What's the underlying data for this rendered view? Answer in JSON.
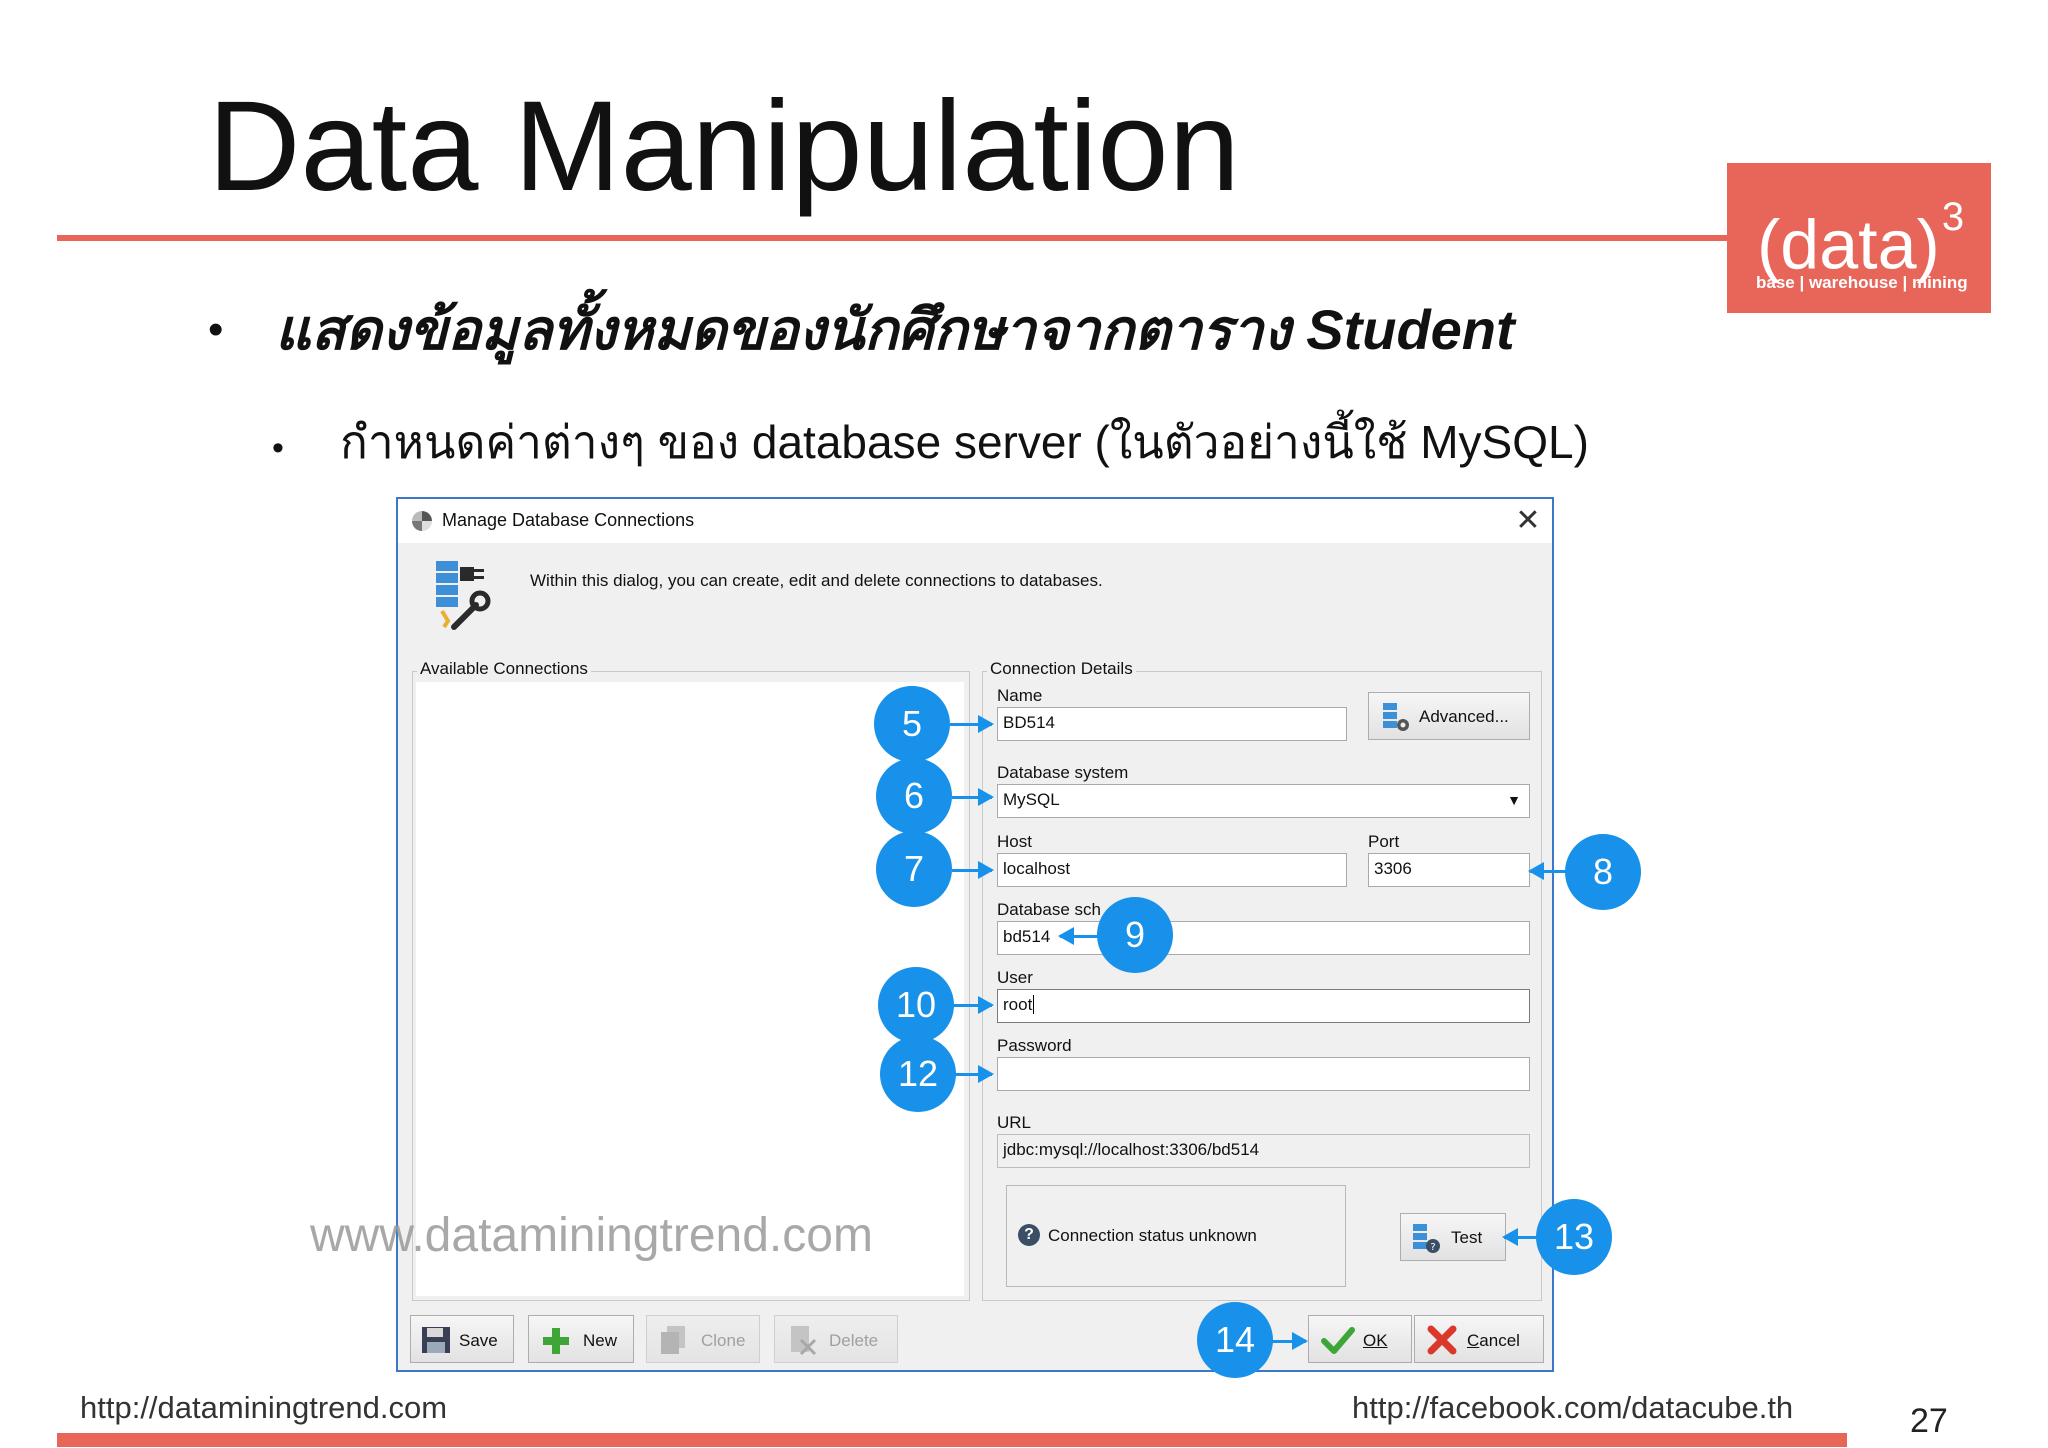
{
  "slide": {
    "title": "Data Manipulation",
    "logo": {
      "main": "(data)",
      "superscript": "3",
      "sub": "base | warehouse | mining"
    },
    "bullet1": "แสดงข้อมูลทั้งหมดของนักศึกษาจากตาราง Student",
    "bullet2": "กำหนดค่าต่างๆ ของ database server (ในตัวอย่างนี้ใช้ MySQL)",
    "footer_left": "http://dataminingtrend.com",
    "footer_right": "http://facebook.com/datacube.th",
    "page_number": "27",
    "watermark": "www.dataminingtrend.com",
    "accent_color": "#e8655a",
    "callout_color": "#1791ea"
  },
  "dialog": {
    "title": "Manage Database Connections",
    "close_icon": "close-icon",
    "description": "Within this dialog, you can create, edit and delete connections to databases.",
    "available_connections_label": "Available Connections",
    "connection_details_label": "Connection Details",
    "fields": {
      "name": {
        "label": "Name",
        "value": "BD514"
      },
      "database_system": {
        "label": "Database system",
        "value": "MySQL"
      },
      "host": {
        "label": "Host",
        "value": "localhost"
      },
      "port": {
        "label": "Port",
        "value": "3306"
      },
      "database_schema": {
        "label": "Database sch",
        "value": "bd514"
      },
      "user": {
        "label": "User",
        "value": "root"
      },
      "password": {
        "label": "Password",
        "value": ""
      },
      "url": {
        "label": "URL",
        "value": "jdbc:mysql://localhost:3306/bd514"
      }
    },
    "advanced_label": "Advanced...",
    "status_text": "Connection status unknown",
    "test_label": "Test",
    "buttons": {
      "save": "Save",
      "new": "New",
      "clone": "Clone",
      "delete": "Delete",
      "ok": "OK",
      "cancel": "Cancel"
    }
  },
  "callouts": [
    "5",
    "6",
    "7",
    "8",
    "9",
    "10",
    "12",
    "13",
    "14"
  ]
}
